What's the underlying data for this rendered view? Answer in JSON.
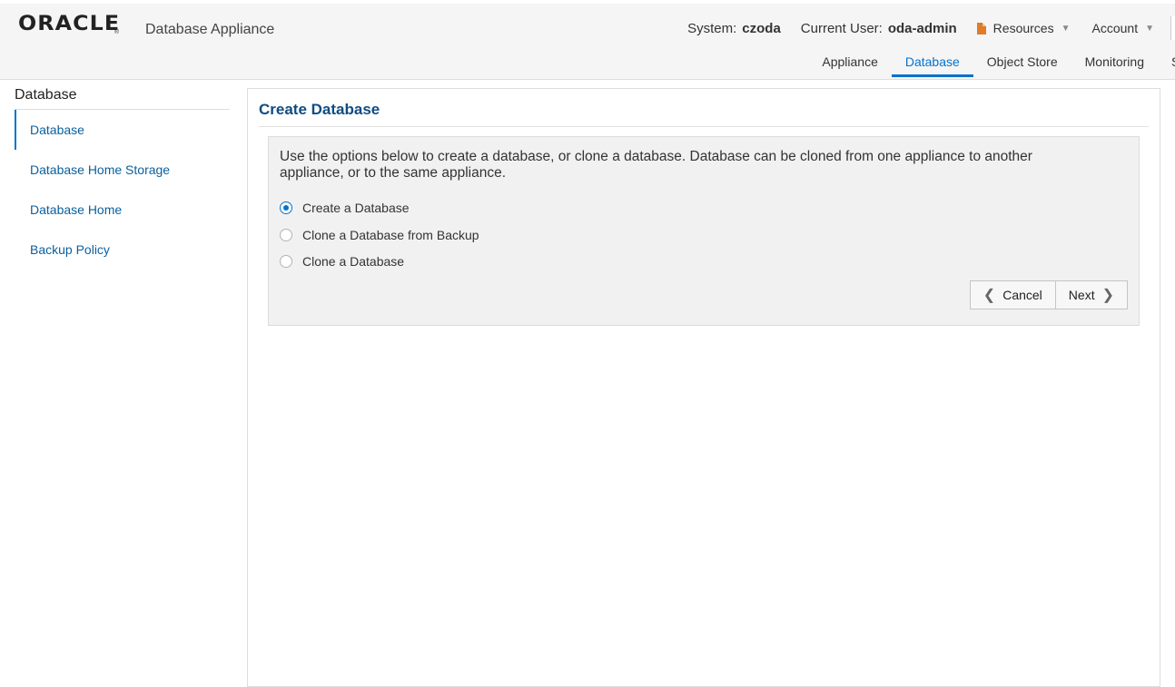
{
  "header": {
    "brand": "ORACLE",
    "brand_mark": "®",
    "app_title": "Database Appliance",
    "system_label": "System:",
    "system_value": "czoda",
    "user_label": "Current User:",
    "user_value": "oda-admin",
    "resources_label": "Resources",
    "resources_icon": "document-icon",
    "account_label": "Account",
    "caret": "▼"
  },
  "nav": {
    "tabs": [
      {
        "label": "Appliance"
      },
      {
        "label": "Database"
      },
      {
        "label": "Object Store"
      },
      {
        "label": "Monitoring"
      },
      {
        "label": "S"
      }
    ],
    "active": "Database"
  },
  "sidebar": {
    "title": "Database",
    "items": [
      {
        "label": "Database"
      },
      {
        "label": "Database Home Storage"
      },
      {
        "label": "Database Home"
      },
      {
        "label": "Backup Policy"
      }
    ]
  },
  "main": {
    "title": "Create Database",
    "description": "Use the options below to create a database, or clone a database. Database can be cloned from one appliance to another appliance, or to the same appliance.",
    "options": [
      {
        "label": "Create a Database",
        "selected": true
      },
      {
        "label": "Clone a Database from Backup",
        "selected": false
      },
      {
        "label": "Clone a Database",
        "selected": false
      }
    ],
    "cancel_label": "Cancel",
    "next_label": "Next"
  },
  "colors": {
    "accent": "#0572ce",
    "link": "#0a5f9e",
    "title": "#0f4c81",
    "resource_icon": "#e07b2a"
  }
}
